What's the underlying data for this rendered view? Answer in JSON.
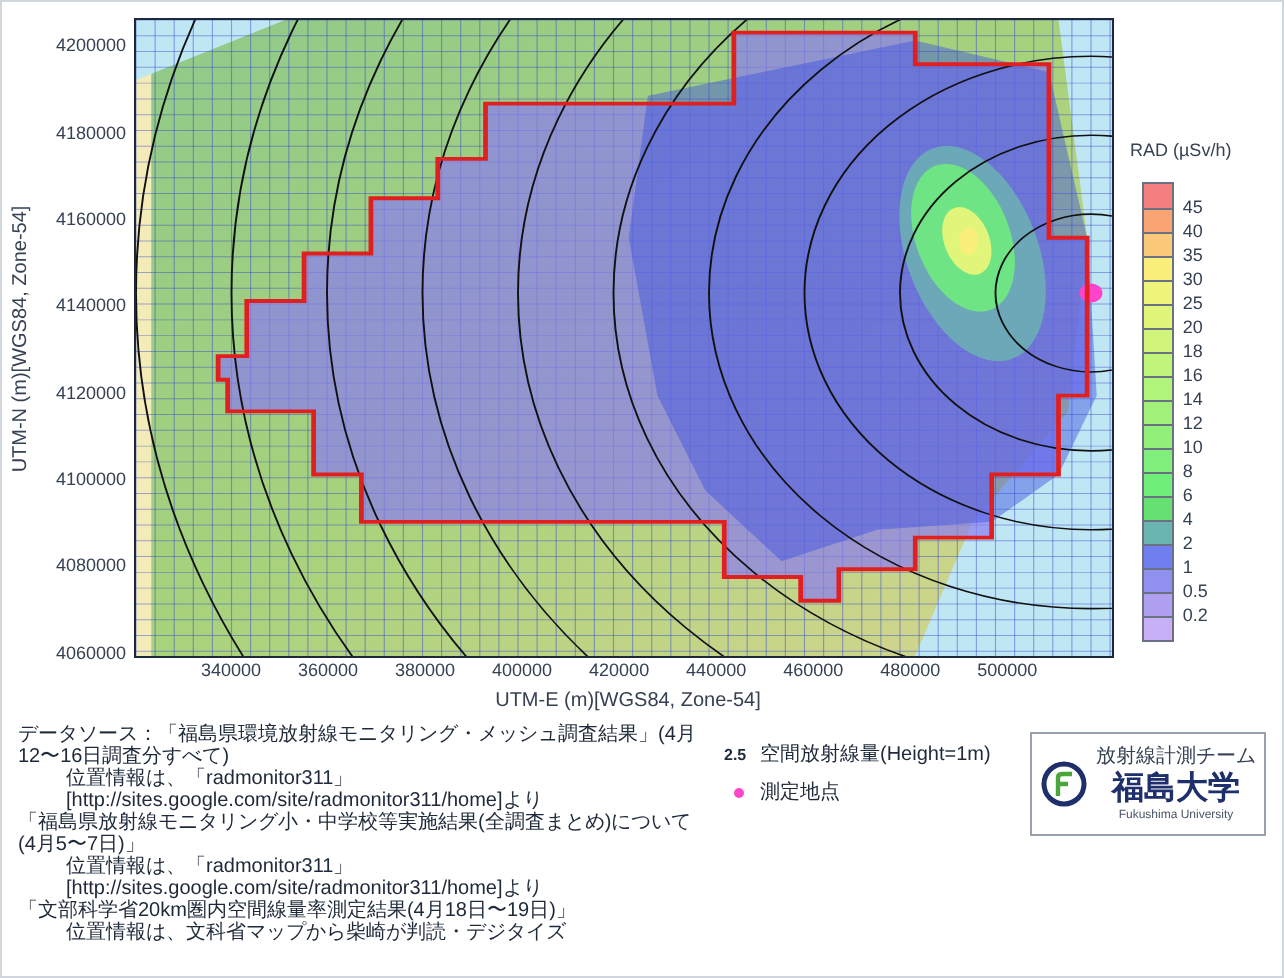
{
  "map": {
    "x_axis": {
      "label": "UTM-E (m)[WGS84, Zone-54]",
      "ticks": [
        "340000",
        "360000",
        "380000",
        "400000",
        "420000",
        "440000",
        "460000",
        "480000",
        "500000"
      ]
    },
    "y_axis": {
      "label": "UTM-N (m)[WGS84, Zone-54]",
      "ticks": [
        "4200000",
        "4180000",
        "4160000",
        "4140000",
        "4120000",
        "4100000",
        "4080000",
        "4060000"
      ]
    }
  },
  "legend": {
    "title": "RAD (µSv/h)",
    "levels": [
      {
        "color": "#f47f7f"
      },
      {
        "label": "45",
        "color": "#f9a472"
      },
      {
        "label": "40",
        "color": "#fbc97a"
      },
      {
        "label": "35",
        "color": "#f9ef7a"
      },
      {
        "label": "30",
        "color": "#eef57a"
      },
      {
        "label": "25",
        "color": "#e0f57a"
      },
      {
        "label": "20",
        "color": "#d0f57a"
      },
      {
        "label": "18",
        "color": "#c0f57a"
      },
      {
        "label": "16",
        "color": "#b0f47a"
      },
      {
        "label": "14",
        "color": "#a0f07a"
      },
      {
        "label": "12",
        "color": "#90f07a"
      },
      {
        "label": "10",
        "color": "#80ee7a"
      },
      {
        "label": "8",
        "color": "#70ee7a"
      },
      {
        "label": "6",
        "color": "#66e070"
      },
      {
        "label": "4",
        "color": "#6bb5b0"
      },
      {
        "label": "2",
        "color": "#6f7ff0"
      },
      {
        "label": "1",
        "color": "#9090f0"
      },
      {
        "label": "0.5",
        "color": "#b0a0f0"
      },
      {
        "label": "0.2",
        "color": "#c8b0f8"
      }
    ]
  },
  "footnotes": [
    {
      "kind": "source",
      "text": "データソース：「福島県環境放射線モニタリング・メッシュ調査結果」(4月12〜16日調査分すべて)"
    },
    {
      "kind": "location",
      "text": "位置情報は、「radmonitor311」[http://sites.google.com/site/radmonitor311/home]より"
    },
    {
      "kind": "source",
      "text": "「福島県放射線モニタリング小・中学校等実施結果(全調査まとめ)について(4月5〜7日)」"
    },
    {
      "kind": "location",
      "text": "位置情報は、「radmonitor311」[http://sites.google.com/site/radmonitor311/home]より"
    },
    {
      "kind": "source",
      "text": "「文部科学省20km圏内空間線量率測定結果(4月18日〜19日)」"
    },
    {
      "kind": "location",
      "text": "位置情報は、文科省マップから柴崎が判読・デジタイズ"
    }
  ],
  "key": [
    {
      "kind": "value",
      "symbol": "2.5",
      "label": "空間放射線量(Height=1m)"
    },
    {
      "kind": "point",
      "label": "測定地点"
    }
  ],
  "logo": {
    "team": "放射線計測チーム",
    "name": "福島大学",
    "name_en": "Fukushima University"
  }
}
